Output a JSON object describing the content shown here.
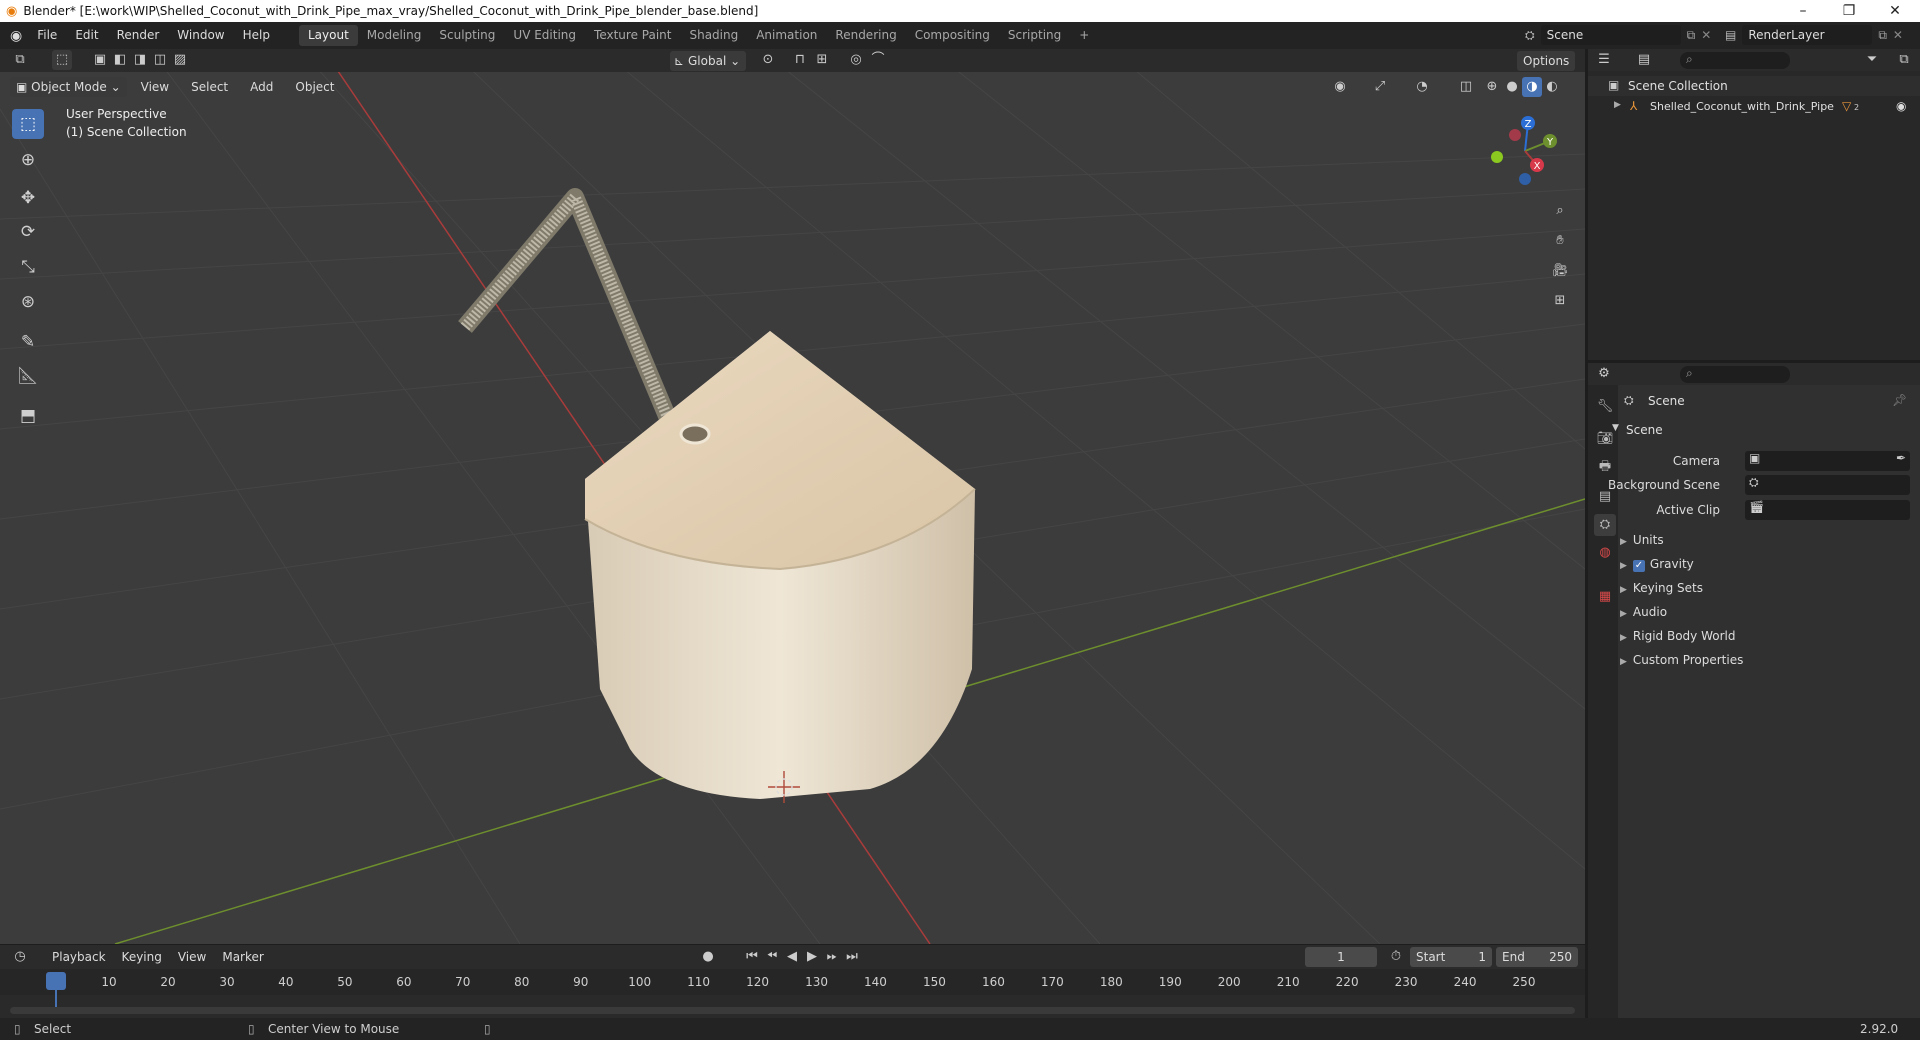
{
  "window": {
    "title": "Blender* [E:\\work\\WIP\\Shelled_Coconut_with_Drink_Pipe_max_vray/Shelled_Coconut_with_Drink_Pipe_blender_base.blend]",
    "minimize": "–",
    "restore": "❐",
    "close": "✕"
  },
  "menu": {
    "items": [
      "File",
      "Edit",
      "Render",
      "Window",
      "Help"
    ]
  },
  "workspaces": [
    "Layout",
    "Modeling",
    "Sculpting",
    "UV Editing",
    "Texture Paint",
    "Shading",
    "Animation",
    "Rendering",
    "Compositing",
    "Scripting"
  ],
  "workspace_add": "+",
  "scene_field": "Scene",
  "renderlayer_field": "RenderLayer",
  "viewport": {
    "mode": "Object Mode",
    "menus": [
      "View",
      "Select",
      "Add",
      "Object"
    ],
    "transform_orientation": "Global",
    "options": "Options",
    "overlay_line1": "User Perspective",
    "overlay_line2": "(1) Scene Collection",
    "gizmo": {
      "z": "Z",
      "y": "Y",
      "x": "X"
    }
  },
  "outliner": {
    "root": "Scene Collection",
    "item": "Shelled_Coconut_with_Drink_Pipe",
    "item_badge": "2"
  },
  "properties": {
    "context": "Scene",
    "panel": "Scene",
    "fields": [
      {
        "label": "Camera"
      },
      {
        "label": "Background Scene"
      },
      {
        "label": "Active Clip"
      }
    ],
    "subpanels": [
      "Units",
      "Gravity",
      "Keying Sets",
      "Audio",
      "Rigid Body World",
      "Custom Properties"
    ],
    "gravity_checked": true
  },
  "timeline": {
    "menus": [
      "Playback",
      "Keying",
      "View",
      "Marker"
    ],
    "current_frame": "1",
    "start_label": "Start",
    "start": "1",
    "end_label": "End",
    "end": "250",
    "ticks": [
      "1",
      "10",
      "20",
      "30",
      "40",
      "50",
      "60",
      "70",
      "80",
      "90",
      "100",
      "110",
      "120",
      "130",
      "140",
      "150",
      "160",
      "170",
      "180",
      "190",
      "200",
      "210",
      "220",
      "230",
      "240",
      "250"
    ]
  },
  "statusbar": {
    "left": "Select",
    "middle": "Center View to Mouse",
    "version": "2.92.0"
  },
  "colors": {
    "accent": "#4772b3",
    "x_axis": "#a93b3b",
    "y_axis": "#6e8f2d",
    "z_axis": "#2b6fd6"
  }
}
